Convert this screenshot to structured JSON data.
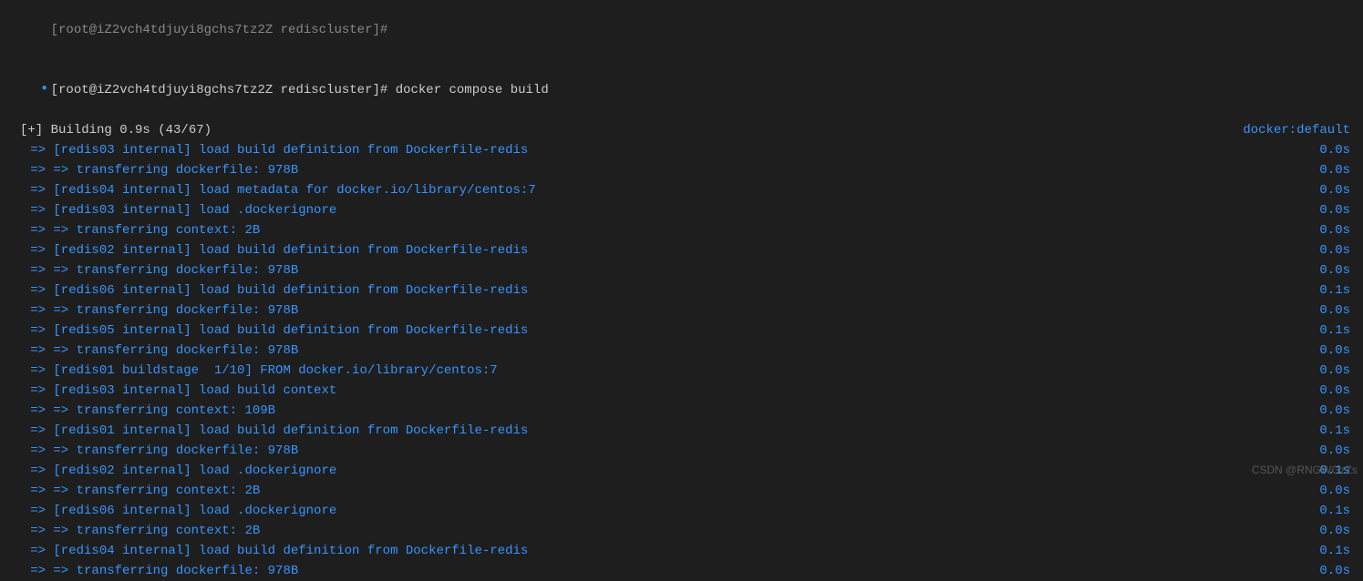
{
  "prompt_prev": "[root@iZ2vch4tdjuyi8gchs7tz2Z rediscluster]#",
  "prompt": "[root@iZ2vch4tdjuyi8gchs7tz2Z rediscluster]#",
  "command": "docker compose build",
  "building_line": "[+] Building 0.9s (43/67)",
  "docker_ctx": "docker:default",
  "steps": [
    {
      "text": "=> [redis03 internal] load build definition from Dockerfile-redis",
      "time": "0.0s"
    },
    {
      "text": "=> => transferring dockerfile: 978B",
      "time": "0.0s"
    },
    {
      "text": "=> [redis04 internal] load metadata for docker.io/library/centos:7",
      "time": "0.0s"
    },
    {
      "text": "=> [redis03 internal] load .dockerignore",
      "time": "0.0s"
    },
    {
      "text": "=> => transferring context: 2B",
      "time": "0.0s"
    },
    {
      "text": "=> [redis02 internal] load build definition from Dockerfile-redis",
      "time": "0.0s"
    },
    {
      "text": "=> => transferring dockerfile: 978B",
      "time": "0.0s"
    },
    {
      "text": "=> [redis06 internal] load build definition from Dockerfile-redis",
      "time": "0.1s"
    },
    {
      "text": "=> => transferring dockerfile: 978B",
      "time": "0.0s"
    },
    {
      "text": "=> [redis05 internal] load build definition from Dockerfile-redis",
      "time": "0.1s"
    },
    {
      "text": "=> => transferring dockerfile: 978B",
      "time": "0.0s"
    },
    {
      "text": "=> [redis01 buildstage  1/10] FROM docker.io/library/centos:7",
      "time": "0.0s"
    },
    {
      "text": "=> [redis03 internal] load build context",
      "time": "0.0s"
    },
    {
      "text": "=> => transferring context: 109B",
      "time": "0.0s"
    },
    {
      "text": "=> [redis01 internal] load build definition from Dockerfile-redis",
      "time": "0.1s"
    },
    {
      "text": "=> => transferring dockerfile: 978B",
      "time": "0.0s"
    },
    {
      "text": "=> [redis02 internal] load .dockerignore",
      "time": "0.1s"
    },
    {
      "text": "=> => transferring context: 2B",
      "time": "0.0s"
    },
    {
      "text": "=> [redis06 internal] load .dockerignore",
      "time": "0.1s"
    },
    {
      "text": "=> => transferring context: 2B",
      "time": "0.0s"
    },
    {
      "text": "=> [redis04 internal] load build definition from Dockerfile-redis",
      "time": "0.1s"
    },
    {
      "text": "=> => transferring dockerfile: 978B",
      "time": "0.0s"
    }
  ],
  "watermark": "CSDN @RNGWGzZs"
}
